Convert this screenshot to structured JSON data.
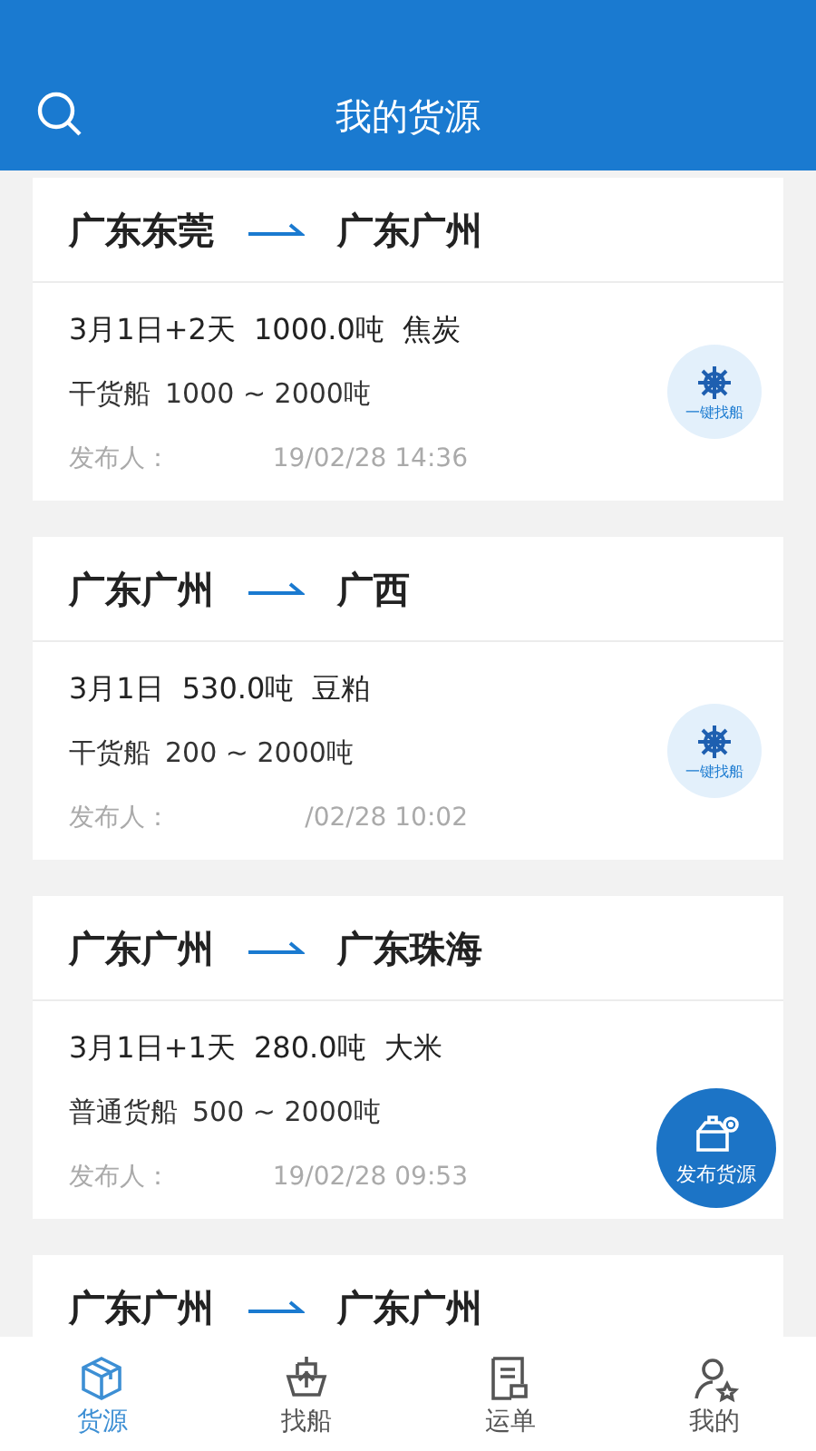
{
  "header": {
    "title": "我的货源"
  },
  "cards": [
    {
      "from": "广东东莞",
      "to": "广东广州",
      "schedule": "3月1日+2天",
      "weight": "1000.0吨",
      "cargo": "焦炭",
      "ship_type": "干货船",
      "tonnage": "1000 ~ 2000吨",
      "publisher_label": "发布人：",
      "time": "19/02/28 14:36",
      "find_ship": "一键找船"
    },
    {
      "from": "广东广州",
      "to": "广西",
      "schedule": "3月1日",
      "weight": "530.0吨",
      "cargo": "豆粕",
      "ship_type": "干货船",
      "tonnage": "200 ~ 2000吨",
      "publisher_label": "发布人：",
      "time": "/02/28 10:02",
      "find_ship": "一键找船"
    },
    {
      "from": "广东广州",
      "to": "广东珠海",
      "schedule": "3月1日+1天",
      "weight": "280.0吨",
      "cargo": "大米",
      "ship_type": "普通货船",
      "tonnage": "500 ~ 2000吨",
      "publisher_label": "发布人：",
      "time": "19/02/28 09:53"
    },
    {
      "from": "广东广州",
      "to": "广东广州"
    }
  ],
  "fab": {
    "label": "发布货源"
  },
  "tabs": [
    {
      "label": "货源",
      "kind": "box",
      "selected": true
    },
    {
      "label": "找船",
      "kind": "ship",
      "selected": false
    },
    {
      "label": "运单",
      "kind": "waybill",
      "selected": false
    },
    {
      "label": "我的",
      "kind": "user",
      "selected": false
    }
  ]
}
